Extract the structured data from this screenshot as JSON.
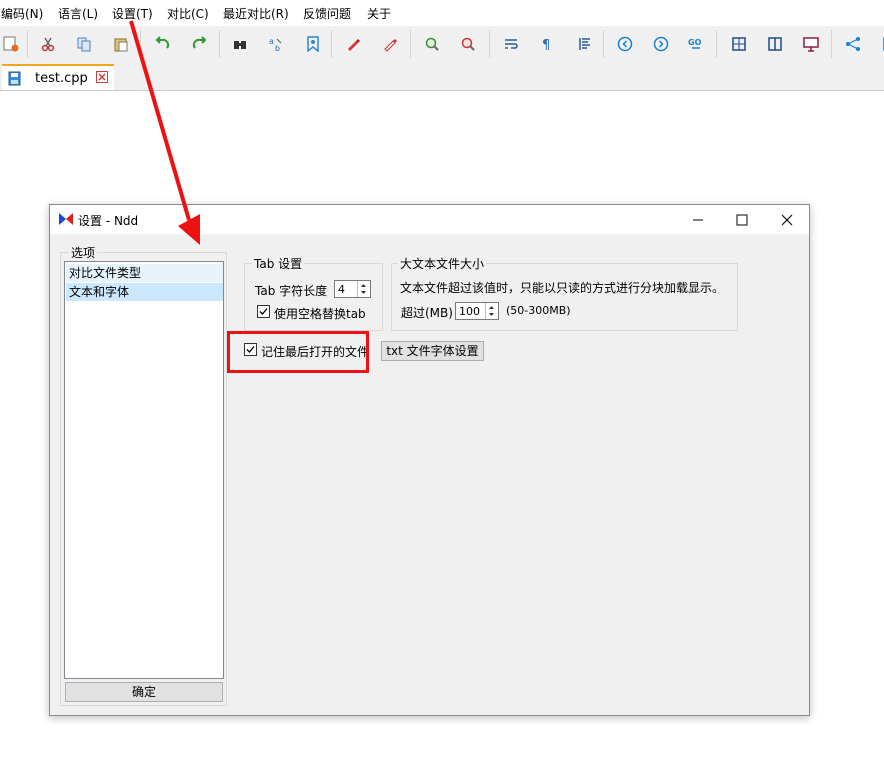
{
  "menu": [
    "编码(N)",
    "语言(L)",
    "设置(T)",
    "对比(C)",
    "最近对比(R)",
    "反馈问题",
    "关于"
  ],
  "tab": {
    "filename": "test.cpp"
  },
  "dialog": {
    "title": "设置 - Ndd",
    "options_group": "选项",
    "options": [
      "对比文件类型",
      "文本和字体"
    ],
    "ok_label": "确定",
    "tab_group": "Tab 设置",
    "tab_width_label": "Tab 字符长度",
    "tab_width_value": "4",
    "use_spaces_label": "使用空格替换tab",
    "use_spaces_checked": true,
    "large_file_group": "大文本文件大小",
    "large_file_desc": "文本文件超过该值时，只能以只读的方式进行分块加载显示。",
    "exceed_label": "超过(MB)",
    "exceed_value": "100",
    "exceed_range": "(50-300MB)",
    "remember_last_file_label": "记住最后打开的文件",
    "remember_last_file_checked": true,
    "txt_font_button": "txt 文件字体设置"
  },
  "colors": {
    "accent_tab": "#f2a61f",
    "annotation_red": "#e11111",
    "selected_item": "#cce8ff"
  }
}
